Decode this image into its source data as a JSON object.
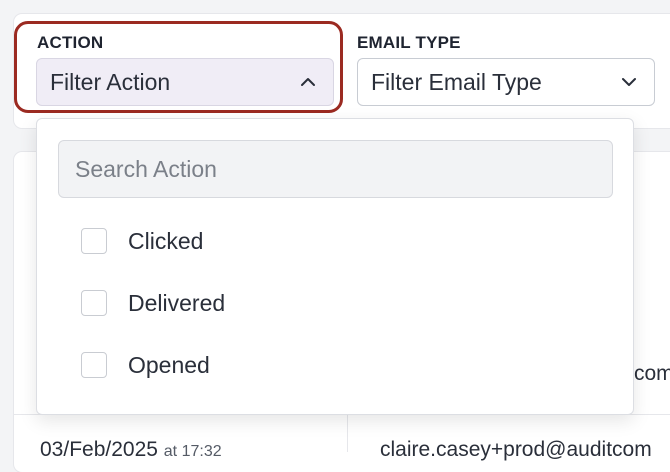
{
  "filters": {
    "action": {
      "label": "ACTION",
      "placeholder": "Filter Action",
      "search_placeholder": "Search Action",
      "options": [
        {
          "label": "Clicked",
          "checked": false
        },
        {
          "label": "Delivered",
          "checked": false
        },
        {
          "label": "Opened",
          "checked": false
        }
      ]
    },
    "email_type": {
      "label": "EMAIL TYPE",
      "placeholder": "Filter Email Type"
    }
  },
  "table": {
    "partial_email_1": "com",
    "partial_date": "03/Feb/2025",
    "partial_time": "at 17:32",
    "partial_email_2": "claire.casey+prod@auditcom"
  },
  "colors": {
    "highlight": "#9b2a21",
    "active_select_bg": "#f0edf6"
  },
  "icons": {
    "action_select": "chevron-up-icon",
    "email_type_select": "chevron-down-icon"
  }
}
